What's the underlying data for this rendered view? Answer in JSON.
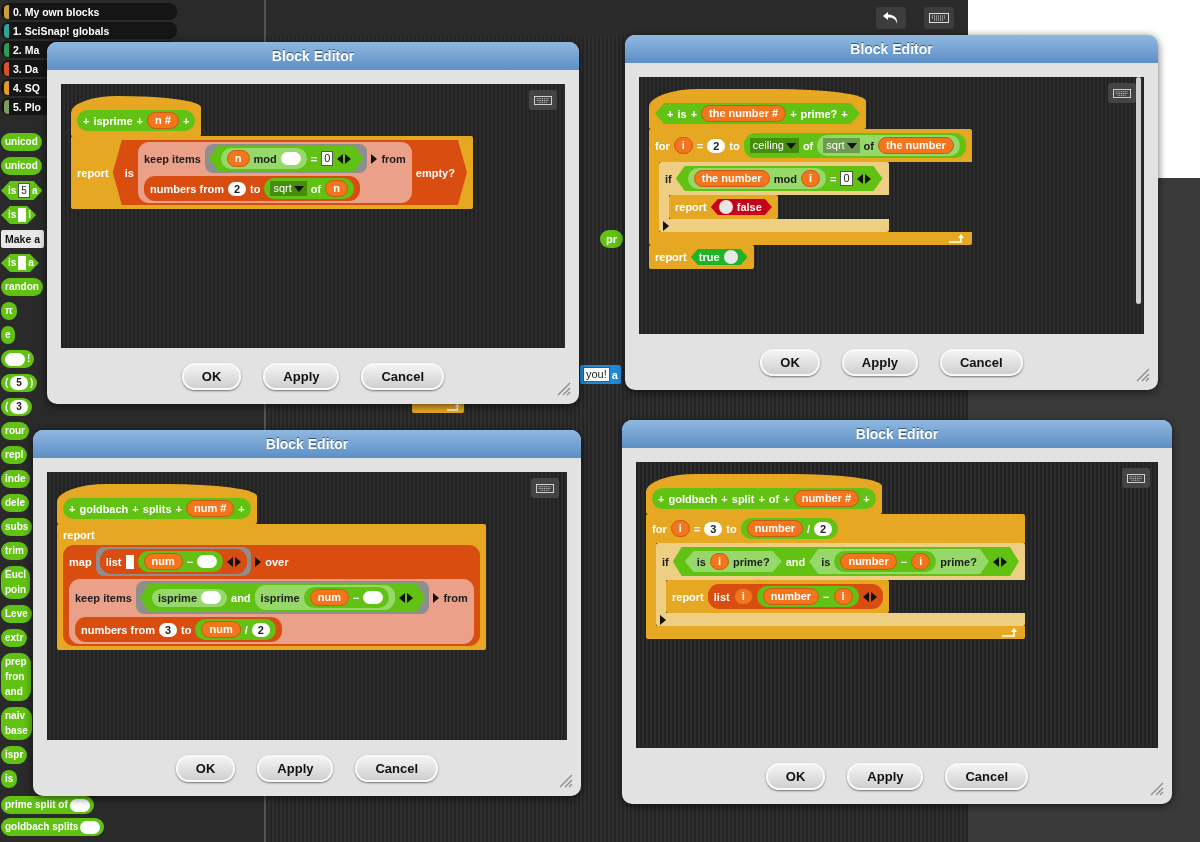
{
  "palette": [
    {
      "kind": "category",
      "text": "0. My own blocks",
      "color": "#c8a040"
    },
    {
      "kind": "category",
      "text": "1. SciSnap! globals",
      "color": "#2fa39a"
    },
    {
      "kind": "category",
      "text": "2. Ma",
      "color": "#2e9a55"
    },
    {
      "kind": "category",
      "text": "3. Da",
      "color": "#d4532c"
    },
    {
      "kind": "category",
      "text": "4. SQ",
      "color": "#e29a2c"
    },
    {
      "kind": "category",
      "text": "5. Plo",
      "color": "#7d9a63"
    },
    {
      "kind": "reporter",
      "color": "#62c213",
      "lines": [
        [
          {
            "kind": "text",
            "text": "unicod"
          }
        ]
      ]
    },
    {
      "kind": "reporter",
      "color": "#62c213",
      "lines": [
        [
          {
            "kind": "text",
            "text": "unicod"
          }
        ]
      ]
    },
    {
      "kind": "predicate",
      "color": "#62c213",
      "lines": [
        [
          {
            "kind": "text",
            "text": "is"
          },
          {
            "kind": "box",
            "text": "5"
          },
          {
            "kind": "text",
            "text": "a"
          }
        ]
      ]
    },
    {
      "kind": "predicate",
      "color": "#62c213",
      "lines": [
        [
          {
            "kind": "text",
            "text": "is"
          },
          {
            "kind": "listslot"
          },
          {
            "kind": "text",
            "text": "i"
          }
        ]
      ]
    },
    {
      "kind": "button",
      "text": "Make a"
    },
    {
      "kind": "predicate",
      "color": "#62c213",
      "lines": [
        [
          {
            "kind": "text",
            "text": "is"
          },
          {
            "kind": "listslot"
          },
          {
            "kind": "text",
            "text": "a"
          }
        ]
      ]
    },
    {
      "kind": "reporter",
      "color": "#62c213",
      "lines": [
        [
          {
            "kind": "text",
            "text": "randon"
          }
        ]
      ]
    },
    {
      "kind": "reporter",
      "color": "#62c213",
      "lines": [
        [
          {
            "kind": "text",
            "text": "π"
          }
        ]
      ]
    },
    {
      "kind": "reporter",
      "color": "#62c213",
      "lines": [
        [
          {
            "kind": "text",
            "text": "e"
          }
        ]
      ]
    },
    {
      "kind": "reporter",
      "color": "#62c213",
      "lines": [
        [
          {
            "kind": "slot"
          },
          {
            "kind": "text",
            "text": "!"
          }
        ]
      ]
    },
    {
      "kind": "reporter",
      "color": "#62c213",
      "lines": [
        [
          {
            "kind": "text",
            "text": "("
          },
          {
            "kind": "num",
            "text": "5"
          },
          {
            "kind": "text",
            "text": ")"
          }
        ]
      ]
    },
    {
      "kind": "reporter",
      "color": "#62c213",
      "lines": [
        [
          {
            "kind": "text",
            "text": "("
          },
          {
            "kind": "num",
            "text": "3"
          }
        ]
      ]
    },
    {
      "kind": "reporter",
      "color": "#62c213",
      "lines": [
        [
          {
            "kind": "text",
            "text": "rour"
          }
        ]
      ]
    },
    {
      "kind": "reporter",
      "color": "#62c213",
      "lines": [
        [
          {
            "kind": "text",
            "text": "repl"
          }
        ]
      ]
    },
    {
      "kind": "reporter",
      "color": "#62c213",
      "lines": [
        [
          {
            "kind": "text",
            "text": "inde"
          }
        ]
      ]
    },
    {
      "kind": "reporter",
      "color": "#62c213",
      "lines": [
        [
          {
            "kind": "text",
            "text": "dele"
          }
        ]
      ]
    },
    {
      "kind": "reporter",
      "color": "#62c213",
      "lines": [
        [
          {
            "kind": "text",
            "text": "subs"
          }
        ]
      ]
    },
    {
      "kind": "reporter",
      "color": "#62c213",
      "lines": [
        [
          {
            "kind": "text",
            "text": "trim"
          }
        ]
      ]
    },
    {
      "kind": "reporter",
      "color": "#62c213",
      "lines": [
        [
          {
            "kind": "text",
            "text": "Eucl"
          }
        ],
        [
          {
            "kind": "text",
            "text": "poin"
          }
        ]
      ]
    },
    {
      "kind": "reporter",
      "color": "#62c213",
      "lines": [
        [
          {
            "kind": "text",
            "text": "Leve"
          }
        ]
      ]
    },
    {
      "kind": "reporter",
      "color": "#62c213",
      "lines": [
        [
          {
            "kind": "text",
            "text": "extr"
          }
        ]
      ]
    },
    {
      "kind": "reporter",
      "color": "#62c213",
      "lines": [
        [
          {
            "kind": "text",
            "text": "prep"
          }
        ],
        [
          {
            "kind": "text",
            "text": "fron"
          }
        ],
        [
          {
            "kind": "text",
            "text": "and"
          }
        ]
      ]
    },
    {
      "kind": "reporter",
      "color": "#62c213",
      "lines": [
        [
          {
            "kind": "text",
            "text": "naiv"
          }
        ],
        [
          {
            "kind": "text",
            "text": "base"
          }
        ]
      ]
    },
    {
      "kind": "reporter",
      "color": "#62c213",
      "lines": [
        [
          {
            "kind": "text",
            "text": "ispr"
          }
        ]
      ]
    },
    {
      "kind": "reporter",
      "color": "#62c213",
      "lines": [
        [
          {
            "kind": "text",
            "text": "is"
          }
        ]
      ]
    }
  ],
  "palette_bottom": [
    {
      "kind": "reporter",
      "color": "#62c213",
      "lines": [
        [
          {
            "kind": "text",
            "text": "prime split of"
          },
          {
            "kind": "slot"
          }
        ]
      ]
    },
    {
      "kind": "reporter",
      "color": "#62c213",
      "lines": [
        [
          {
            "kind": "text",
            "text": "goldbach splits"
          },
          {
            "kind": "slot"
          }
        ]
      ]
    }
  ],
  "workspace_fragments": [
    {
      "kind": "reporter",
      "color": "#62c213",
      "lines": [
        [
          {
            "kind": "text",
            "text": "pr"
          }
        ]
      ]
    },
    {
      "kind": "command",
      "color": "#1f8ad8",
      "lines": [
        [
          {
            "kind": "box",
            "text": "you!"
          },
          {
            "kind": "text",
            "text": "a"
          }
        ]
      ]
    }
  ],
  "editors": [
    {
      "title": "Block Editor",
      "buttons": [
        "OK",
        "Apply",
        "Cancel"
      ],
      "scrollbar": false,
      "script": [
        {
          "kind": "hat",
          "proto": {
            "kind": "reporter",
            "color": "#62c213",
            "lines": [
              [
                {
                  "kind": "text",
                  "text": "+"
                },
                {
                  "kind": "text",
                  "text": "isprime"
                },
                {
                  "kind": "text",
                  "text": "+"
                },
                {
                  "kind": "var",
                  "text": "n #"
                },
                {
                  "kind": "text",
                  "text": "+"
                }
              ]
            ]
          }
        },
        {
          "kind": "command",
          "color": "#e6a822",
          "lines": [
            [
              {
                "kind": "text",
                "text": "report"
              },
              {
                "kind": "predicate",
                "color": "#d94d11",
                "lines": [
                  [
                    {
                      "kind": "text",
                      "text": "is"
                    },
                    {
                      "kind": "reporter",
                      "color": "#eba08a",
                      "lines": [
                        [
                          {
                            "kind": "text",
                            "text": "keep items"
                          },
                          {
                            "kind": "ring",
                            "lines": [
                              [
                                {
                                  "kind": "predicate",
                                  "color": "#62c213",
                                  "lines": [
                                    [
                                      {
                                        "kind": "reporter",
                                        "color": "#96d96a",
                                        "lines": [
                                          [
                                            {
                                              "kind": "var",
                                              "text": "n"
                                            },
                                            {
                                              "kind": "text",
                                              "text": "mod"
                                            },
                                            {
                                              "kind": "slot"
                                            }
                                          ]
                                        ]
                                      },
                                      {
                                        "kind": "text",
                                        "text": "="
                                      },
                                      {
                                        "kind": "box",
                                        "text": "0"
                                      },
                                      {
                                        "kind": "arrows"
                                      }
                                    ]
                                  ]
                                }
                              ]
                            ]
                          },
                          {
                            "kind": "expand"
                          },
                          {
                            "kind": "text",
                            "text": "from"
                          }
                        ],
                        [
                          {
                            "kind": "reporter",
                            "color": "#d94d11",
                            "lines": [
                              [
                                {
                                  "kind": "text",
                                  "text": "numbers from"
                                },
                                {
                                  "kind": "num",
                                  "text": "2"
                                },
                                {
                                  "kind": "text",
                                  "text": "to"
                                },
                                {
                                  "kind": "reporter",
                                  "color": "#62c213",
                                  "lines": [
                                    [
                                      {
                                        "kind": "dropdown",
                                        "text": "sqrt"
                                      },
                                      {
                                        "kind": "text",
                                        "text": "of"
                                      },
                                      {
                                        "kind": "var",
                                        "text": "n"
                                      }
                                    ]
                                  ]
                                }
                              ]
                            ]
                          }
                        ]
                      ]
                    },
                    {
                      "kind": "text",
                      "text": "empty?"
                    }
                  ]
                ]
              }
            ]
          ]
        }
      ]
    },
    {
      "title": "Block Editor",
      "buttons": [
        "OK",
        "Apply",
        "Cancel"
      ],
      "scrollbar": true,
      "script": [
        {
          "kind": "hat",
          "proto": {
            "kind": "predicate",
            "color": "#62c213",
            "lines": [
              [
                {
                  "kind": "text",
                  "text": "+"
                },
                {
                  "kind": "text",
                  "text": "is"
                },
                {
                  "kind": "text",
                  "text": "+"
                },
                {
                  "kind": "var",
                  "text": "the number #"
                },
                {
                  "kind": "text",
                  "text": "+"
                },
                {
                  "kind": "text",
                  "text": "prime?"
                },
                {
                  "kind": "text",
                  "text": "+"
                }
              ]
            ]
          }
        },
        {
          "kind": "command",
          "color": "#e6a822",
          "loop_arrow": true,
          "lines": [
            [
              {
                "kind": "text",
                "text": "for"
              },
              {
                "kind": "var",
                "text": "i"
              },
              {
                "kind": "text",
                "text": "="
              },
              {
                "kind": "num",
                "text": "2"
              },
              {
                "kind": "text",
                "text": "to"
              },
              {
                "kind": "reporter",
                "color": "#62c213",
                "lines": [
                  [
                    {
                      "kind": "dropdown",
                      "text": "ceiling"
                    },
                    {
                      "kind": "text",
                      "text": "of"
                    },
                    {
                      "kind": "reporter",
                      "color": "#96d96a",
                      "lines": [
                        [
                          {
                            "kind": "dropdown",
                            "text": "sqrt"
                          },
                          {
                            "kind": "text",
                            "text": "of"
                          },
                          {
                            "kind": "var",
                            "text": "the number"
                          }
                        ]
                      ]
                    }
                  ]
                ]
              }
            ]
          ],
          "children": [
            {
              "kind": "command",
              "color": "#edce82",
              "expand_arrow": true,
              "lines": [
                [
                  {
                    "kind": "text",
                    "text": "if"
                  },
                  {
                    "kind": "predicate",
                    "color": "#62c213",
                    "lines": [
                      [
                        {
                          "kind": "reporter",
                          "color": "#96d96a",
                          "lines": [
                            [
                              {
                                "kind": "var",
                                "text": "the number"
                              },
                              {
                                "kind": "text",
                                "text": "mod"
                              },
                              {
                                "kind": "var",
                                "text": "i"
                              }
                            ]
                          ]
                        },
                        {
                          "kind": "text",
                          "text": "="
                        },
                        {
                          "kind": "box",
                          "text": "0"
                        },
                        {
                          "kind": "arrows"
                        }
                      ]
                    ]
                  }
                ]
              ],
              "children": [
                {
                  "kind": "command",
                  "color": "#e6a822",
                  "lines": [
                    [
                      {
                        "kind": "text",
                        "text": "report"
                      },
                      {
                        "kind": "bool",
                        "text": "false",
                        "value": false
                      }
                    ]
                  ]
                }
              ]
            }
          ]
        },
        {
          "kind": "command",
          "color": "#e6a822",
          "lines": [
            [
              {
                "kind": "text",
                "text": "report"
              },
              {
                "kind": "bool",
                "text": "true",
                "value": true
              }
            ]
          ]
        }
      ]
    },
    {
      "title": "Block Editor",
      "buttons": [
        "OK",
        "Apply",
        "Cancel"
      ],
      "scrollbar": false,
      "script": [
        {
          "kind": "hat",
          "proto": {
            "kind": "reporter",
            "color": "#62c213",
            "lines": [
              [
                {
                  "kind": "text",
                  "text": "+"
                },
                {
                  "kind": "text",
                  "text": "goldbach"
                },
                {
                  "kind": "text",
                  "text": "+"
                },
                {
                  "kind": "text",
                  "text": "splits"
                },
                {
                  "kind": "text",
                  "text": "+"
                },
                {
                  "kind": "var",
                  "text": "num #"
                },
                {
                  "kind": "text",
                  "text": "+"
                }
              ]
            ]
          }
        },
        {
          "kind": "command",
          "color": "#e6a822",
          "lines": [
            [
              {
                "kind": "text",
                "text": "report"
              }
            ],
            [
              {
                "kind": "reporter",
                "color": "#d94d11",
                "lines": [
                  [
                    {
                      "kind": "text",
                      "text": "map"
                    },
                    {
                      "kind": "ring",
                      "lines": [
                        [
                          {
                            "kind": "reporter",
                            "color": "#d94d11",
                            "lines": [
                              [
                                {
                                  "kind": "text",
                                  "text": "list"
                                },
                                {
                                  "kind": "listslot"
                                },
                                {
                                  "kind": "reporter",
                                  "color": "#62c213",
                                  "lines": [
                                    [
                                      {
                                        "kind": "var",
                                        "text": "num"
                                      },
                                      {
                                        "kind": "text",
                                        "text": "−"
                                      },
                                      {
                                        "kind": "slot"
                                      }
                                    ]
                                  ]
                                },
                                {
                                  "kind": "arrows"
                                }
                              ]
                            ]
                          }
                        ]
                      ]
                    },
                    {
                      "kind": "expand"
                    },
                    {
                      "kind": "text",
                      "text": "over"
                    }
                  ],
                  [
                    {
                      "kind": "reporter",
                      "color": "#eba08a",
                      "lines": [
                        [
                          {
                            "kind": "text",
                            "text": "keep items"
                          },
                          {
                            "kind": "ring",
                            "lines": [
                              [
                                {
                                  "kind": "predicate",
                                  "color": "#62c213",
                                  "lines": [
                                    [
                                      {
                                        "kind": "reporter",
                                        "color": "#96d96a",
                                        "lines": [
                                          [
                                            {
                                              "kind": "text",
                                              "text": "isprime"
                                            },
                                            {
                                              "kind": "slot"
                                            }
                                          ]
                                        ]
                                      },
                                      {
                                        "kind": "text",
                                        "text": "and"
                                      },
                                      {
                                        "kind": "reporter",
                                        "color": "#96d96a",
                                        "lines": [
                                          [
                                            {
                                              "kind": "text",
                                              "text": "isprime"
                                            },
                                            {
                                              "kind": "reporter",
                                              "color": "#62c213",
                                              "lines": [
                                                [
                                                  {
                                                    "kind": "var",
                                                    "text": "num"
                                                  },
                                                  {
                                                    "kind": "text",
                                                    "text": "−"
                                                  },
                                                  {
                                                    "kind": "slot"
                                                  }
                                                ]
                                              ]
                                            }
                                          ]
                                        ]
                                      },
                                      {
                                        "kind": "arrows"
                                      }
                                    ]
                                  ]
                                }
                              ]
                            ]
                          },
                          {
                            "kind": "expand"
                          },
                          {
                            "kind": "text",
                            "text": "from"
                          }
                        ],
                        [
                          {
                            "kind": "reporter",
                            "color": "#d94d11",
                            "lines": [
                              [
                                {
                                  "kind": "text",
                                  "text": "numbers from"
                                },
                                {
                                  "kind": "num",
                                  "text": "3"
                                },
                                {
                                  "kind": "text",
                                  "text": "to"
                                },
                                {
                                  "kind": "reporter",
                                  "color": "#62c213",
                                  "lines": [
                                    [
                                      {
                                        "kind": "var",
                                        "text": "num"
                                      },
                                      {
                                        "kind": "text",
                                        "text": "/"
                                      },
                                      {
                                        "kind": "num",
                                        "text": "2"
                                      }
                                    ]
                                  ]
                                }
                              ]
                            ]
                          }
                        ]
                      ]
                    }
                  ]
                ]
              }
            ]
          ]
        }
      ]
    },
    {
      "title": "Block Editor",
      "buttons": [
        "OK",
        "Apply",
        "Cancel"
      ],
      "scrollbar": false,
      "script": [
        {
          "kind": "hat",
          "proto": {
            "kind": "reporter",
            "color": "#62c213",
            "lines": [
              [
                {
                  "kind": "text",
                  "text": "+"
                },
                {
                  "kind": "text",
                  "text": "goldbach"
                },
                {
                  "kind": "text",
                  "text": "+"
                },
                {
                  "kind": "text",
                  "text": "split"
                },
                {
                  "kind": "text",
                  "text": "+"
                },
                {
                  "kind": "text",
                  "text": "of"
                },
                {
                  "kind": "text",
                  "text": "+"
                },
                {
                  "kind": "var",
                  "text": "number #"
                },
                {
                  "kind": "text",
                  "text": "+"
                }
              ]
            ]
          }
        },
        {
          "kind": "command",
          "color": "#e6a822",
          "loop_arrow": true,
          "lines": [
            [
              {
                "kind": "text",
                "text": "for"
              },
              {
                "kind": "var",
                "text": "i"
              },
              {
                "kind": "text",
                "text": "="
              },
              {
                "kind": "num",
                "text": "3"
              },
              {
                "kind": "text",
                "text": "to"
              },
              {
                "kind": "reporter",
                "color": "#62c213",
                "lines": [
                  [
                    {
                      "kind": "var",
                      "text": "number"
                    },
                    {
                      "kind": "text",
                      "text": "/"
                    },
                    {
                      "kind": "num",
                      "text": "2"
                    }
                  ]
                ]
              }
            ]
          ],
          "children": [
            {
              "kind": "command",
              "color": "#edce82",
              "expand_arrow": true,
              "lines": [
                [
                  {
                    "kind": "text",
                    "text": "if"
                  },
                  {
                    "kind": "predicate",
                    "color": "#62c213",
                    "lines": [
                      [
                        {
                          "kind": "predicate",
                          "color": "#96d96a",
                          "lines": [
                            [
                              {
                                "kind": "text",
                                "text": "is"
                              },
                              {
                                "kind": "var",
                                "text": "i"
                              },
                              {
                                "kind": "text",
                                "text": "prime?"
                              }
                            ]
                          ]
                        },
                        {
                          "kind": "text",
                          "text": "and"
                        },
                        {
                          "kind": "predicate",
                          "color": "#96d96a",
                          "lines": [
                            [
                              {
                                "kind": "text",
                                "text": "is"
                              },
                              {
                                "kind": "reporter",
                                "color": "#62c213",
                                "lines": [
                                  [
                                    {
                                      "kind": "var",
                                      "text": "number"
                                    },
                                    {
                                      "kind": "text",
                                      "text": "−"
                                    },
                                    {
                                      "kind": "var",
                                      "text": "i"
                                    }
                                  ]
                                ]
                              },
                              {
                                "kind": "text",
                                "text": "prime?"
                              }
                            ]
                          ]
                        },
                        {
                          "kind": "arrows"
                        }
                      ]
                    ]
                  }
                ]
              ],
              "children": [
                {
                  "kind": "command",
                  "color": "#e6a822",
                  "lines": [
                    [
                      {
                        "kind": "text",
                        "text": "report"
                      },
                      {
                        "kind": "reporter",
                        "color": "#d94d11",
                        "lines": [
                          [
                            {
                              "kind": "text",
                              "text": "list"
                            },
                            {
                              "kind": "var",
                              "text": "i"
                            },
                            {
                              "kind": "reporter",
                              "color": "#62c213",
                              "lines": [
                                [
                                  {
                                    "kind": "var",
                                    "text": "number"
                                  },
                                  {
                                    "kind": "text",
                                    "text": "−"
                                  },
                                  {
                                    "kind": "var",
                                    "text": "i"
                                  }
                                ]
                              ]
                            },
                            {
                              "kind": "arrows"
                            }
                          ]
                        ]
                      }
                    ]
                  ]
                }
              ]
            }
          ]
        }
      ]
    }
  ]
}
